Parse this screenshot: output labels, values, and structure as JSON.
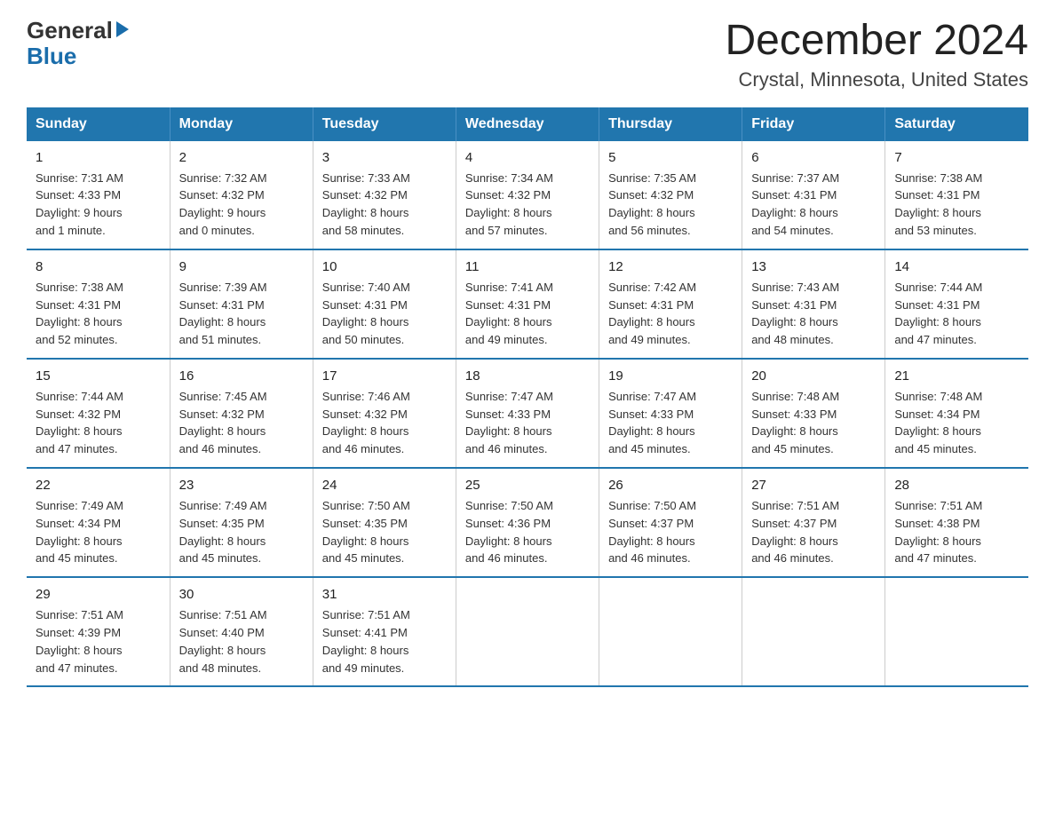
{
  "header": {
    "logo_general": "General",
    "logo_blue": "Blue",
    "title": "December 2024",
    "subtitle": "Crystal, Minnesota, United States"
  },
  "days_of_week": [
    "Sunday",
    "Monday",
    "Tuesday",
    "Wednesday",
    "Thursday",
    "Friday",
    "Saturday"
  ],
  "weeks": [
    [
      {
        "day": "1",
        "sunrise": "7:31 AM",
        "sunset": "4:33 PM",
        "daylight": "9 hours and 1 minute."
      },
      {
        "day": "2",
        "sunrise": "7:32 AM",
        "sunset": "4:32 PM",
        "daylight": "9 hours and 0 minutes."
      },
      {
        "day": "3",
        "sunrise": "7:33 AM",
        "sunset": "4:32 PM",
        "daylight": "8 hours and 58 minutes."
      },
      {
        "day": "4",
        "sunrise": "7:34 AM",
        "sunset": "4:32 PM",
        "daylight": "8 hours and 57 minutes."
      },
      {
        "day": "5",
        "sunrise": "7:35 AM",
        "sunset": "4:32 PM",
        "daylight": "8 hours and 56 minutes."
      },
      {
        "day": "6",
        "sunrise": "7:37 AM",
        "sunset": "4:31 PM",
        "daylight": "8 hours and 54 minutes."
      },
      {
        "day": "7",
        "sunrise": "7:38 AM",
        "sunset": "4:31 PM",
        "daylight": "8 hours and 53 minutes."
      }
    ],
    [
      {
        "day": "8",
        "sunrise": "7:38 AM",
        "sunset": "4:31 PM",
        "daylight": "8 hours and 52 minutes."
      },
      {
        "day": "9",
        "sunrise": "7:39 AM",
        "sunset": "4:31 PM",
        "daylight": "8 hours and 51 minutes."
      },
      {
        "day": "10",
        "sunrise": "7:40 AM",
        "sunset": "4:31 PM",
        "daylight": "8 hours and 50 minutes."
      },
      {
        "day": "11",
        "sunrise": "7:41 AM",
        "sunset": "4:31 PM",
        "daylight": "8 hours and 49 minutes."
      },
      {
        "day": "12",
        "sunrise": "7:42 AM",
        "sunset": "4:31 PM",
        "daylight": "8 hours and 49 minutes."
      },
      {
        "day": "13",
        "sunrise": "7:43 AM",
        "sunset": "4:31 PM",
        "daylight": "8 hours and 48 minutes."
      },
      {
        "day": "14",
        "sunrise": "7:44 AM",
        "sunset": "4:31 PM",
        "daylight": "8 hours and 47 minutes."
      }
    ],
    [
      {
        "day": "15",
        "sunrise": "7:44 AM",
        "sunset": "4:32 PM",
        "daylight": "8 hours and 47 minutes."
      },
      {
        "day": "16",
        "sunrise": "7:45 AM",
        "sunset": "4:32 PM",
        "daylight": "8 hours and 46 minutes."
      },
      {
        "day": "17",
        "sunrise": "7:46 AM",
        "sunset": "4:32 PM",
        "daylight": "8 hours and 46 minutes."
      },
      {
        "day": "18",
        "sunrise": "7:47 AM",
        "sunset": "4:33 PM",
        "daylight": "8 hours and 46 minutes."
      },
      {
        "day": "19",
        "sunrise": "7:47 AM",
        "sunset": "4:33 PM",
        "daylight": "8 hours and 45 minutes."
      },
      {
        "day": "20",
        "sunrise": "7:48 AM",
        "sunset": "4:33 PM",
        "daylight": "8 hours and 45 minutes."
      },
      {
        "day": "21",
        "sunrise": "7:48 AM",
        "sunset": "4:34 PM",
        "daylight": "8 hours and 45 minutes."
      }
    ],
    [
      {
        "day": "22",
        "sunrise": "7:49 AM",
        "sunset": "4:34 PM",
        "daylight": "8 hours and 45 minutes."
      },
      {
        "day": "23",
        "sunrise": "7:49 AM",
        "sunset": "4:35 PM",
        "daylight": "8 hours and 45 minutes."
      },
      {
        "day": "24",
        "sunrise": "7:50 AM",
        "sunset": "4:35 PM",
        "daylight": "8 hours and 45 minutes."
      },
      {
        "day": "25",
        "sunrise": "7:50 AM",
        "sunset": "4:36 PM",
        "daylight": "8 hours and 46 minutes."
      },
      {
        "day": "26",
        "sunrise": "7:50 AM",
        "sunset": "4:37 PM",
        "daylight": "8 hours and 46 minutes."
      },
      {
        "day": "27",
        "sunrise": "7:51 AM",
        "sunset": "4:37 PM",
        "daylight": "8 hours and 46 minutes."
      },
      {
        "day": "28",
        "sunrise": "7:51 AM",
        "sunset": "4:38 PM",
        "daylight": "8 hours and 47 minutes."
      }
    ],
    [
      {
        "day": "29",
        "sunrise": "7:51 AM",
        "sunset": "4:39 PM",
        "daylight": "8 hours and 47 minutes."
      },
      {
        "day": "30",
        "sunrise": "7:51 AM",
        "sunset": "4:40 PM",
        "daylight": "8 hours and 48 minutes."
      },
      {
        "day": "31",
        "sunrise": "7:51 AM",
        "sunset": "4:41 PM",
        "daylight": "8 hours and 49 minutes."
      },
      null,
      null,
      null,
      null
    ]
  ],
  "labels": {
    "sunrise": "Sunrise:",
    "sunset": "Sunset:",
    "daylight": "Daylight:"
  },
  "colors": {
    "header_bg": "#2176ae",
    "border_blue": "#2176ae"
  }
}
